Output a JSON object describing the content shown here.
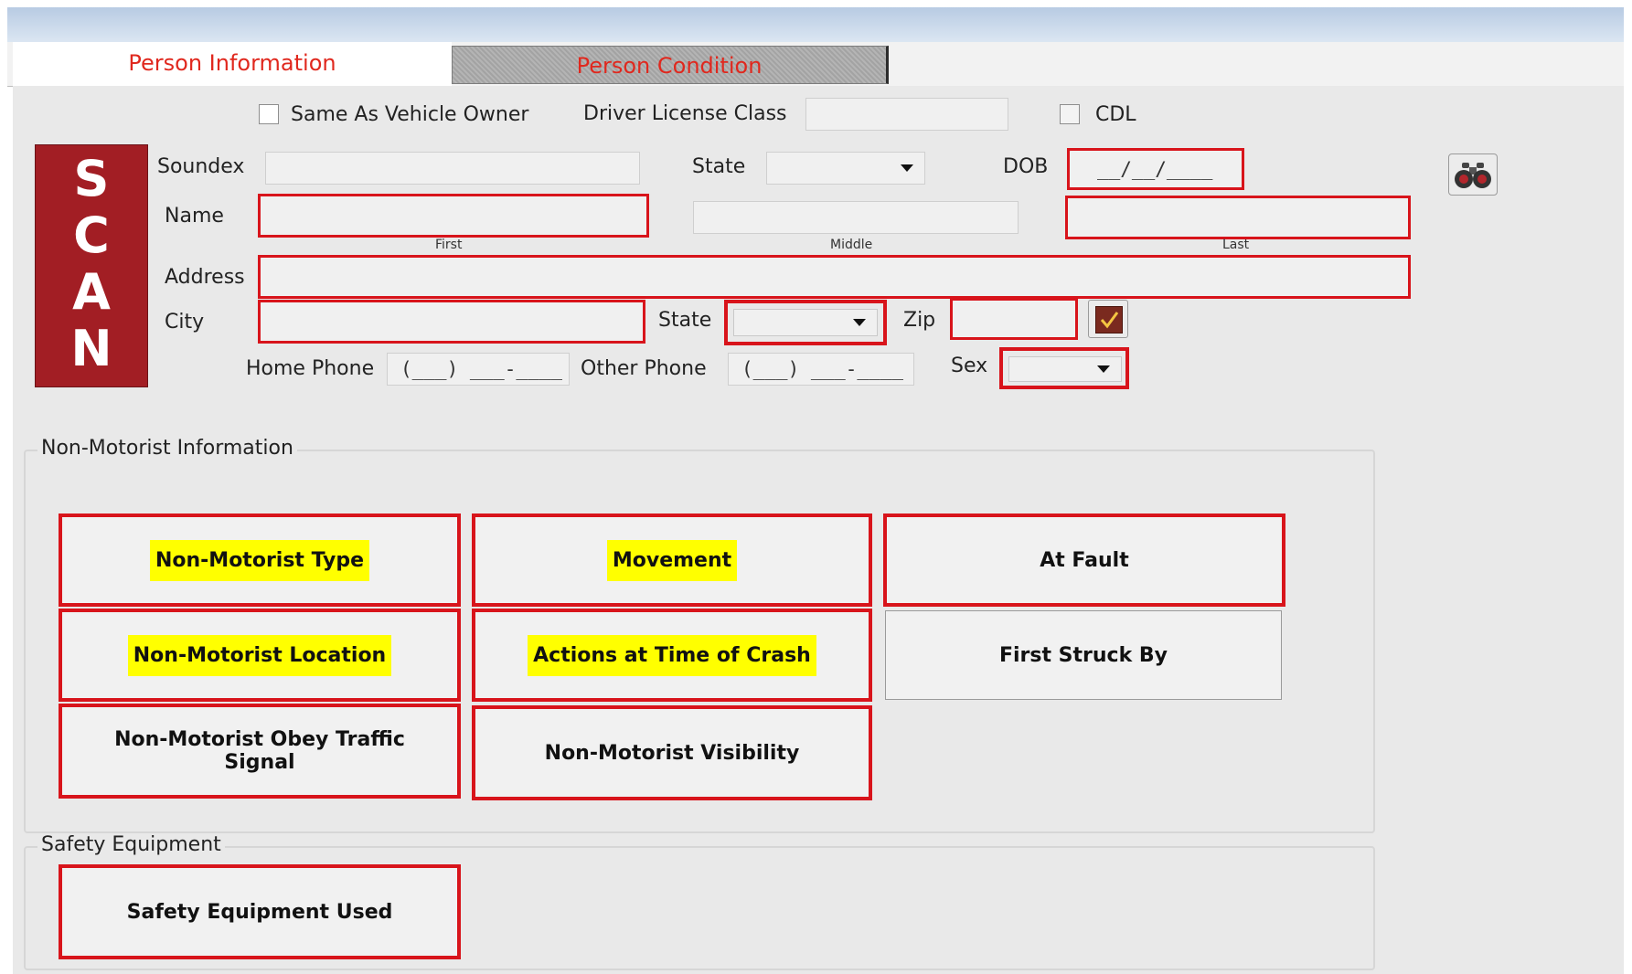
{
  "tabs": [
    {
      "label": "Person Information",
      "active": true
    },
    {
      "label": "Person Condition",
      "active": false
    }
  ],
  "header_row": {
    "same_as_owner_label": "Same As Vehicle Owner",
    "dl_class_label": "Driver License Class",
    "cdl_label": "CDL"
  },
  "scan": {
    "letters": [
      "S",
      "C",
      "A",
      "N"
    ]
  },
  "labels": {
    "soundex": "Soundex",
    "state": "State",
    "dob": "DOB",
    "name": "Name",
    "first": "First",
    "middle": "Middle",
    "last": "Last",
    "address": "Address",
    "city": "City",
    "state2": "State",
    "zip": "Zip",
    "home_phone": "Home Phone",
    "other_phone": "Other Phone",
    "sex": "Sex"
  },
  "fields": {
    "dob_mask": "__/__/____",
    "home_phone_mask": "(___) ___-____",
    "other_phone_mask": "(___) ___-____"
  },
  "non_motorist": {
    "title": "Non-Motorist Information",
    "buttons": {
      "type": "Non-Motorist Type",
      "movement": "Movement",
      "at_fault": "At Fault",
      "location": "Non-Motorist Location",
      "actions": "Actions at Time of Crash",
      "first_struck": "First Struck By",
      "obey": "Non-Motorist Obey Traffic Signal",
      "visibility": "Non-Motorist Visibility"
    }
  },
  "safety": {
    "title": "Safety Equipment",
    "button": "Safety Equipment Used"
  },
  "icons": [
    "binoculars-icon",
    "checkmark-icon",
    "chevron-down-icon"
  ],
  "colors": {
    "required_border": "#d8141b",
    "scan_bg": "#a21e24",
    "highlight": "#ffff00",
    "tab_text": "#e0281e"
  }
}
